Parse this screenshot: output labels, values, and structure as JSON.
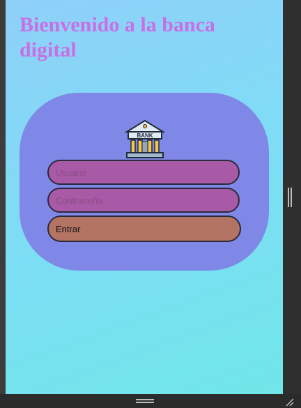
{
  "page": {
    "title": "Bienvenido a la banca digital"
  },
  "login": {
    "logo_text": "BANK",
    "user_placeholder": "Usuario",
    "password_placeholder": "Contraseña",
    "submit_label": "Entrar"
  },
  "colors": {
    "title": "#c86fe6",
    "card": "#7f88e6",
    "field": "#a95aa6",
    "button": "#b37463"
  }
}
